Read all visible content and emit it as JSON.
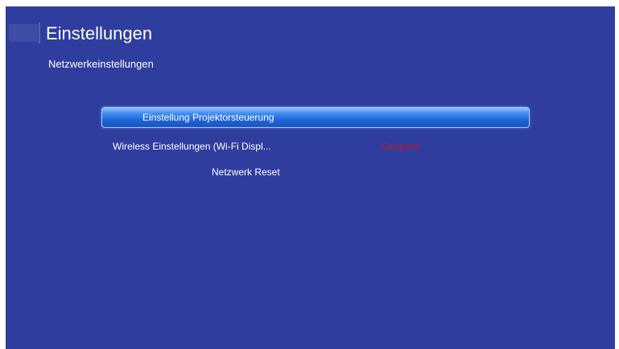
{
  "header": {
    "title": "Einstellungen",
    "subtitle": "Netzwerkeinstellungen"
  },
  "menu": {
    "items": [
      {
        "label": "Einstellung Projektorsteuerung",
        "selected": true
      },
      {
        "label": "Wireless Einstellungen (Wi-Fi Displ...",
        "value": "Gesperrt"
      },
      {
        "label": "Netzwerk Reset"
      }
    ]
  },
  "colors": {
    "background": "#2f3e9e",
    "highlight": "#1f63d6",
    "locked_value": "#c0182a"
  }
}
